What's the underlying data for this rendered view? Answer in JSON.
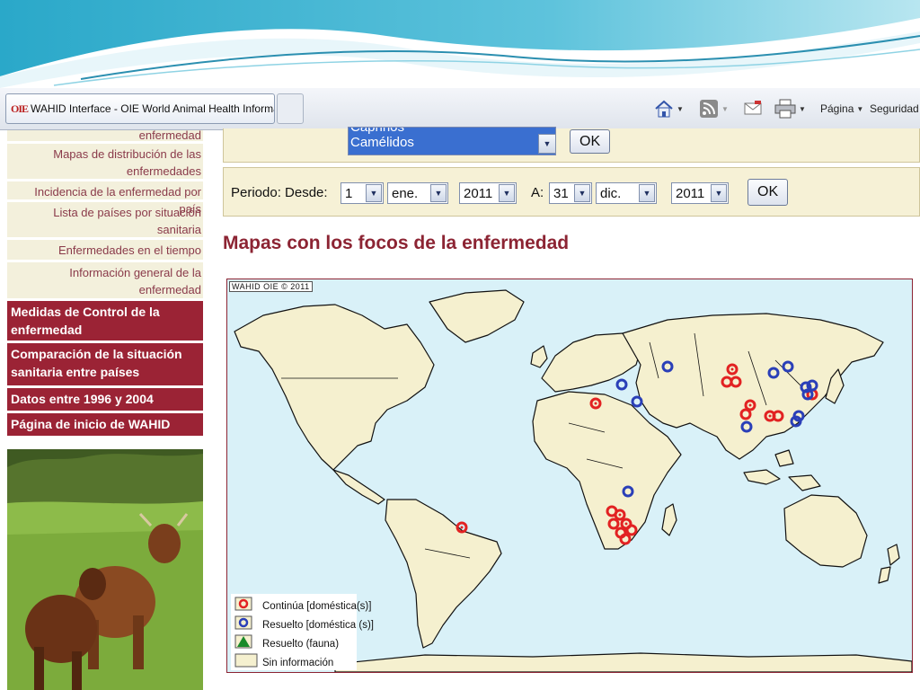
{
  "colors": {
    "maroon": "#9b2335",
    "panel_bg": "#f6f1d6",
    "ocean": "#d9f1f8",
    "land": "#f5f0cf",
    "continuing_marker": "#e22222",
    "resolved_marker": "#2a3fb8",
    "fauna_marker": "#1a8a2a"
  },
  "browser": {
    "tab_favicon": "OIE",
    "tab_title": "WAHID Interface - OIE World Animal Health Informati...",
    "toolbar": {
      "home_icon": "home-icon",
      "rss_icon": "rss-feed-icon",
      "mail_icon": "read-mail-icon",
      "print_icon": "print-icon",
      "page_menu": "Página",
      "security_menu": "Seguridad"
    }
  },
  "sidebar": {
    "partial_item": "enfermedad",
    "links": [
      "Mapas de distribución de las enfermedades",
      "Incidencia de la enfermedad por país",
      "Lista de países por situación sanitaria",
      "Enfermedades en el tiempo",
      "Información general de la enfermedad"
    ],
    "sections": [
      "Medidas de Control de la enfermedad",
      "Comparación de la situación sanitaria entre países",
      "Datos entre 1996 y 2004",
      "Página de inicio de WAHID"
    ]
  },
  "species_filter": {
    "items": [
      "Caprinos",
      "Camélidos"
    ],
    "ok_label": "OK"
  },
  "period": {
    "label": "Periodo: Desde:",
    "from_day": "1",
    "from_month": "ene.",
    "from_year": "2011",
    "to_label": "A:",
    "to_day": "31",
    "to_month": "dic.",
    "to_year": "2011",
    "ok_label": "OK"
  },
  "map": {
    "title": "Mapas con los focos de la enfermedad",
    "copyright": "WAHID OIE © 2011",
    "legend": [
      {
        "label": "Continúa  [doméstica(s)]",
        "icon": "red-circle-marker-icon"
      },
      {
        "label": "Resuelto [doméstica (s)]",
        "icon": "blue-circle-marker-icon"
      },
      {
        "label": "Resuelto (fauna)",
        "icon": "green-triangle-marker-icon"
      },
      {
        "label": "Sin información",
        "icon": "empty-box-icon"
      }
    ]
  }
}
